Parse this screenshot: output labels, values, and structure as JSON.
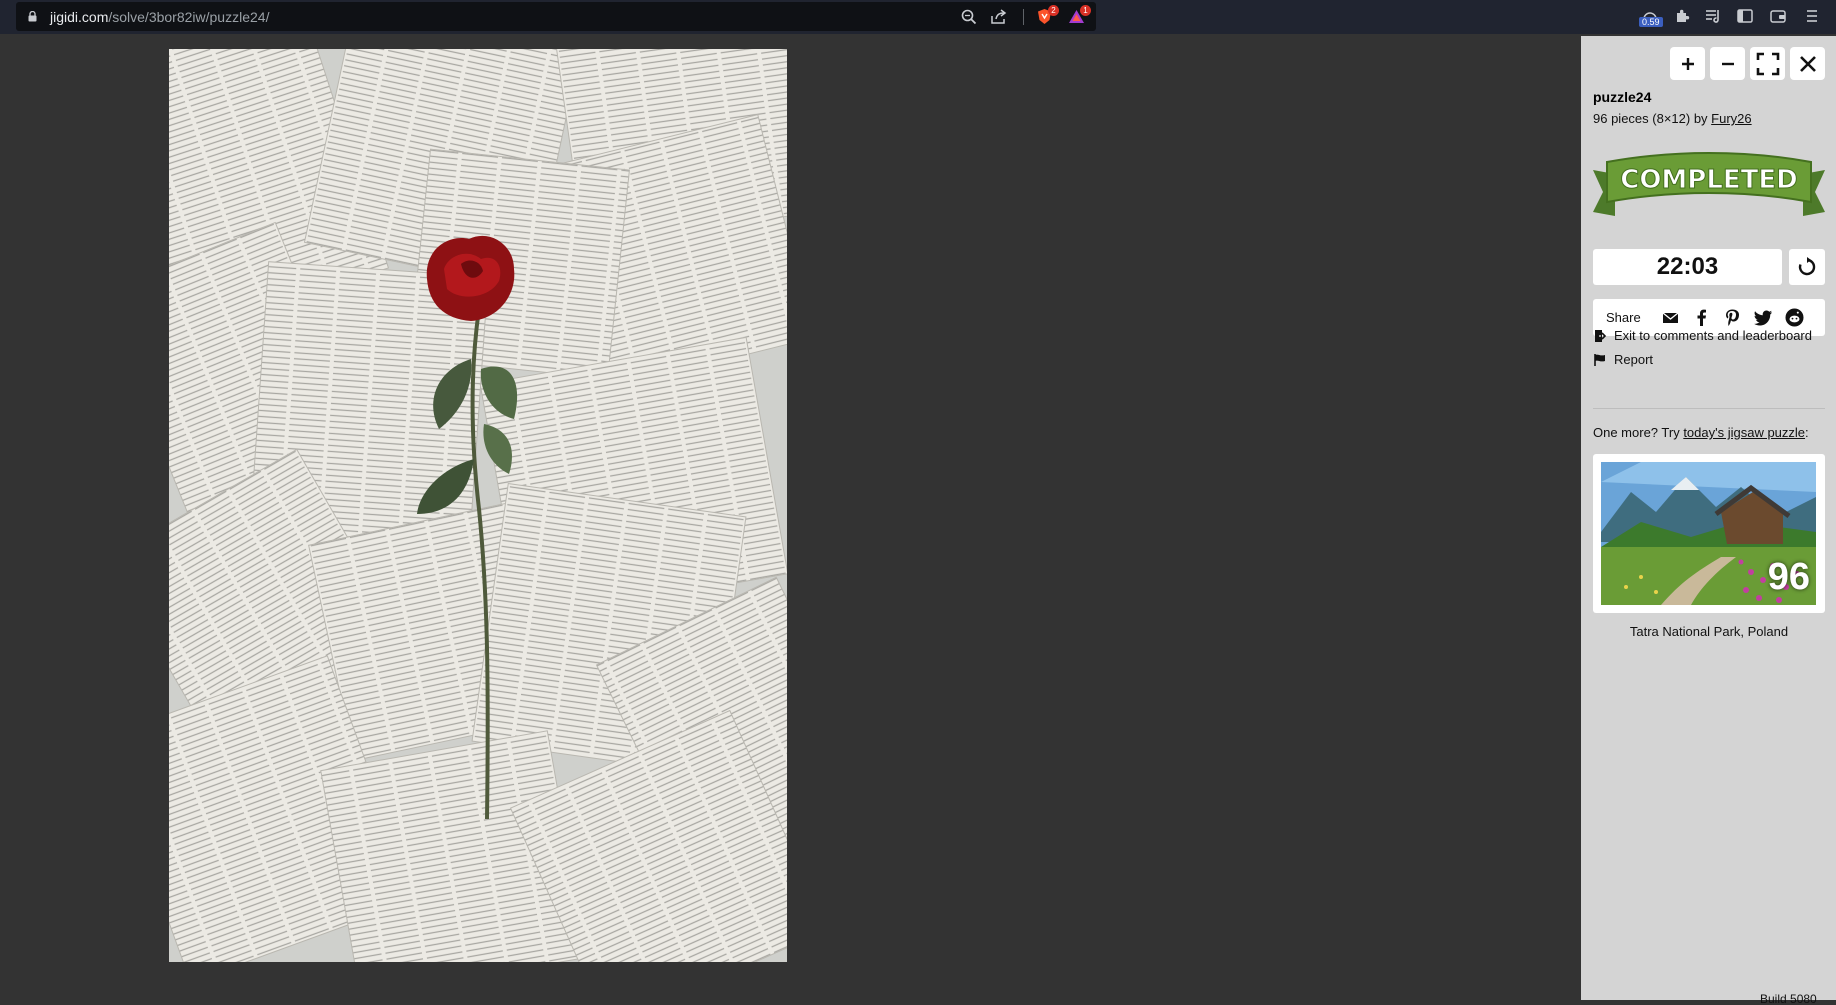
{
  "browser": {
    "url_host": "jigidi.com",
    "url_path": "/solve/3bor82iw/puzzle24/",
    "brave_shield_count": "2",
    "rewards_count": "1",
    "speed_readout": "0.59",
    "icons": [
      "lock-icon",
      "zoom-icon",
      "share-icon",
      "brave-shields-icon",
      "brave-rewards-icon",
      "extensions-icon",
      "playlist-icon",
      "sidebar-icon",
      "wallet-icon",
      "menu-icon"
    ]
  },
  "controls": {
    "zoom_in": "+",
    "zoom_out": "−",
    "icons": [
      "plus-icon",
      "minus-icon",
      "fullscreen-icon",
      "close-icon"
    ]
  },
  "puzzle": {
    "title": "puzzle24",
    "meta_prefix": "96 pieces (8×12) by ",
    "author": "Fury26",
    "status": "COMPLETED",
    "timer": "22:03"
  },
  "share": {
    "label": "Share",
    "icons": [
      "email-icon",
      "facebook-icon",
      "pinterest-icon",
      "twitter-icon",
      "reddit-icon"
    ]
  },
  "links": {
    "exit": "Exit to comments and leaderboard",
    "report": "Report"
  },
  "promo": {
    "prefix": "One more? Try ",
    "link": "today's jigsaw puzzle",
    "suffix": ":",
    "pieces": "96",
    "caption": "Tatra National Park, Poland"
  },
  "corner_text": "Build 5080"
}
